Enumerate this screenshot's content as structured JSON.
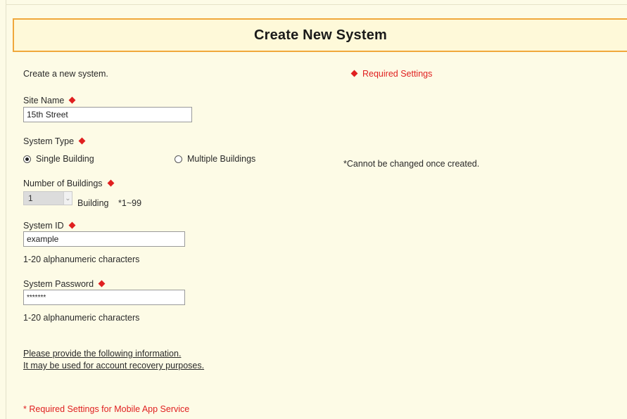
{
  "header": {
    "title": "Create New System"
  },
  "intro": {
    "text": "Create a new system.",
    "required_note": "Required Settings"
  },
  "site_name": {
    "label": "Site Name",
    "value": "15th Street"
  },
  "system_type": {
    "label": "System Type",
    "options": [
      {
        "label": "Single Building",
        "selected": true
      },
      {
        "label": "Multiple Buildings",
        "selected": false
      }
    ],
    "note": "*Cannot be changed once created."
  },
  "buildings": {
    "label": "Number of Buildings",
    "value": "1",
    "unit": "Building",
    "range": "*1~99"
  },
  "system_id": {
    "label": "System ID",
    "value": "example",
    "hint": "1-20 alphanumeric characters"
  },
  "system_password": {
    "label": "System Password",
    "value": "*******",
    "hint": "1-20 alphanumeric characters"
  },
  "recovery": {
    "line1": "Please provide the following information.",
    "line2": "It may be used for account recovery purposes."
  },
  "mobile": {
    "note": "* Required Settings for Mobile App Service"
  },
  "colors": {
    "accent_border": "#f0a83c",
    "required": "#e02020",
    "background": "#fdfbe6"
  }
}
